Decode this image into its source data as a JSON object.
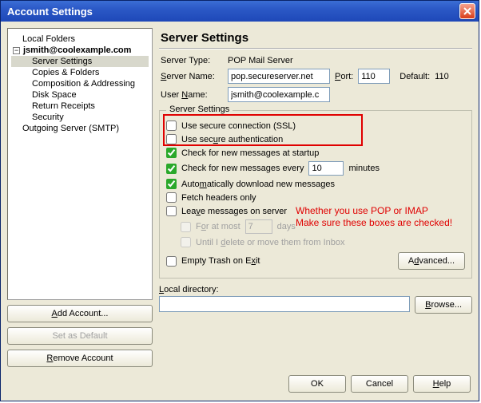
{
  "window": {
    "title": "Account Settings"
  },
  "tree": {
    "local_folders": "Local Folders",
    "account": "jsmith@coolexample.com",
    "items": [
      "Server Settings",
      "Copies & Folders",
      "Composition & Addressing",
      "Disk Space",
      "Return Receipts",
      "Security"
    ],
    "outgoing": "Outgoing Server (SMTP)"
  },
  "sidebar_buttons": {
    "add": "Add Account...",
    "default": "Set as Default",
    "remove": "Remove Account"
  },
  "main": {
    "heading": "Server Settings",
    "server_type_label": "Server Type:",
    "server_type_value": "POP Mail Server",
    "server_name_label": "Server Name:",
    "server_name_value": "pop.secureserver.net",
    "port_label": "Port:",
    "port_value": "110",
    "default_port_label": "Default:",
    "default_port_value": "110",
    "user_name_label": "User Name:",
    "user_name_value": "jsmith@coolexample.c"
  },
  "server_settings": {
    "legend": "Server Settings",
    "ssl": "Use secure connection (SSL)",
    "auth": "Use secure authentication",
    "startup": "Check for new messages at startup",
    "every_prefix": "Check for new messages every",
    "every_value": "10",
    "every_suffix": "minutes",
    "auto_dl": "Automatically download new messages",
    "fetch_headers": "Fetch headers only",
    "leave_msgs": "Leave messages on server",
    "for_at_most": "For at most",
    "days_value": "7",
    "days_suffix": "days",
    "until_delete": "Until I delete or move them from Inbox",
    "empty_trash": "Empty Trash on Exit",
    "advanced": "Advanced..."
  },
  "annotation": {
    "line1": "Whether you use POP or IMAP",
    "line2": "Make sure these boxes are checked!"
  },
  "local_dir": {
    "label": "Local directory:",
    "value": "",
    "browse": "Browse..."
  },
  "footer": {
    "ok": "OK",
    "cancel": "Cancel",
    "help": "Help"
  }
}
